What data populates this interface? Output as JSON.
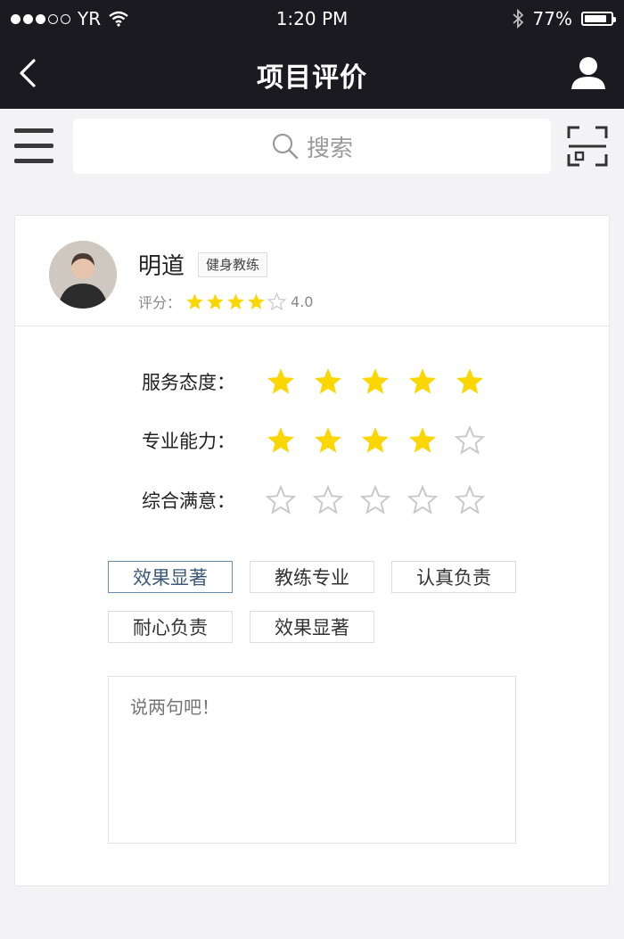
{
  "status_bar": {
    "carrier": "YR",
    "time": "1:20 PM",
    "battery": "77%"
  },
  "nav": {
    "title": "项目评价"
  },
  "search": {
    "placeholder": "搜索"
  },
  "profile": {
    "name": "明道",
    "tag": "健身教练",
    "rating_label": "评分：",
    "rating_value": "4.0",
    "stars": 4
  },
  "criteria": [
    {
      "label": "服务态度：",
      "stars": 5
    },
    {
      "label": "专业能力：",
      "stars": 4
    },
    {
      "label": "综合满意：",
      "stars": 0
    }
  ],
  "tags": [
    {
      "label": "效果显著",
      "selected": true
    },
    {
      "label": "教练专业",
      "selected": false
    },
    {
      "label": "认真负责",
      "selected": false
    },
    {
      "label": "耐心负责",
      "selected": false
    },
    {
      "label": "效果显著",
      "selected": false
    }
  ],
  "comment": {
    "placeholder": "说两句吧！"
  },
  "colors": {
    "header_bg": "#1b1a20",
    "star_fill": "#fcd600",
    "star_outline": "#c9c9c9",
    "selected_tag_border": "#6b8aa8"
  }
}
